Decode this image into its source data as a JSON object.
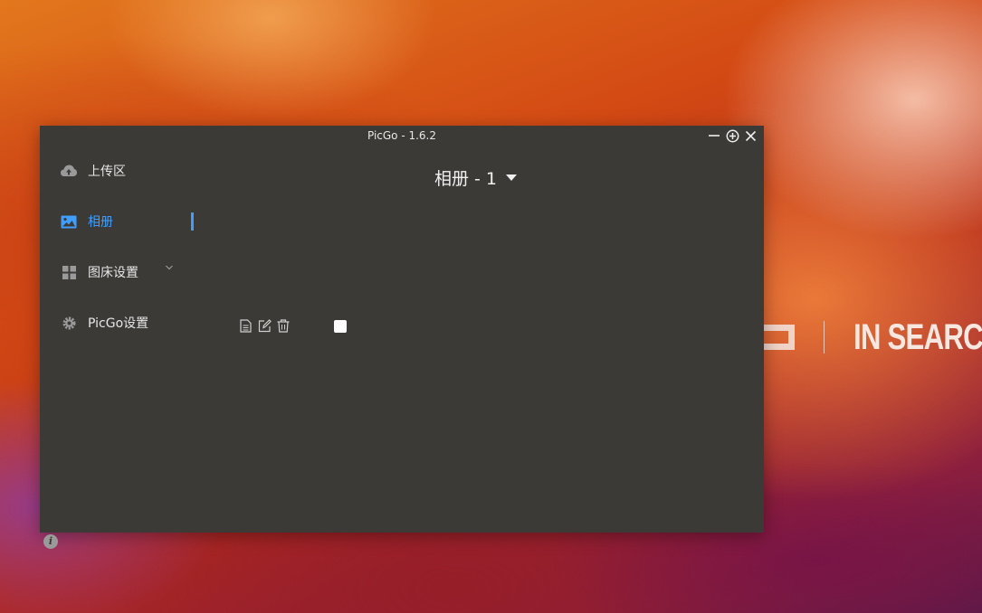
{
  "wallpaper": {
    "brand_text": "IN SEARCH"
  },
  "window": {
    "title": "PicGo - 1.6.2",
    "controls": {
      "minimize_icon": "minus-icon",
      "maximize_icon": "circle-plus-icon",
      "close_icon": "close-icon"
    }
  },
  "sidebar": {
    "items": [
      {
        "label": "上传区",
        "icon": "cloud-upload-icon"
      },
      {
        "label": "相册",
        "icon": "image-icon",
        "active": true
      },
      {
        "label": "图床设置",
        "icon": "grid-icon",
        "has_submenu": true
      },
      {
        "label": "PicGo设置",
        "icon": "gear-icon"
      }
    ],
    "active_color": "#409eff",
    "info_icon": "i"
  },
  "main": {
    "album_title": "相册 - 1",
    "item_actions": [
      "file-icon",
      "edit-icon",
      "trash-icon"
    ],
    "item_checked": false
  },
  "colors": {
    "window_bg": "#3c3a37",
    "accent": "#409eff"
  }
}
